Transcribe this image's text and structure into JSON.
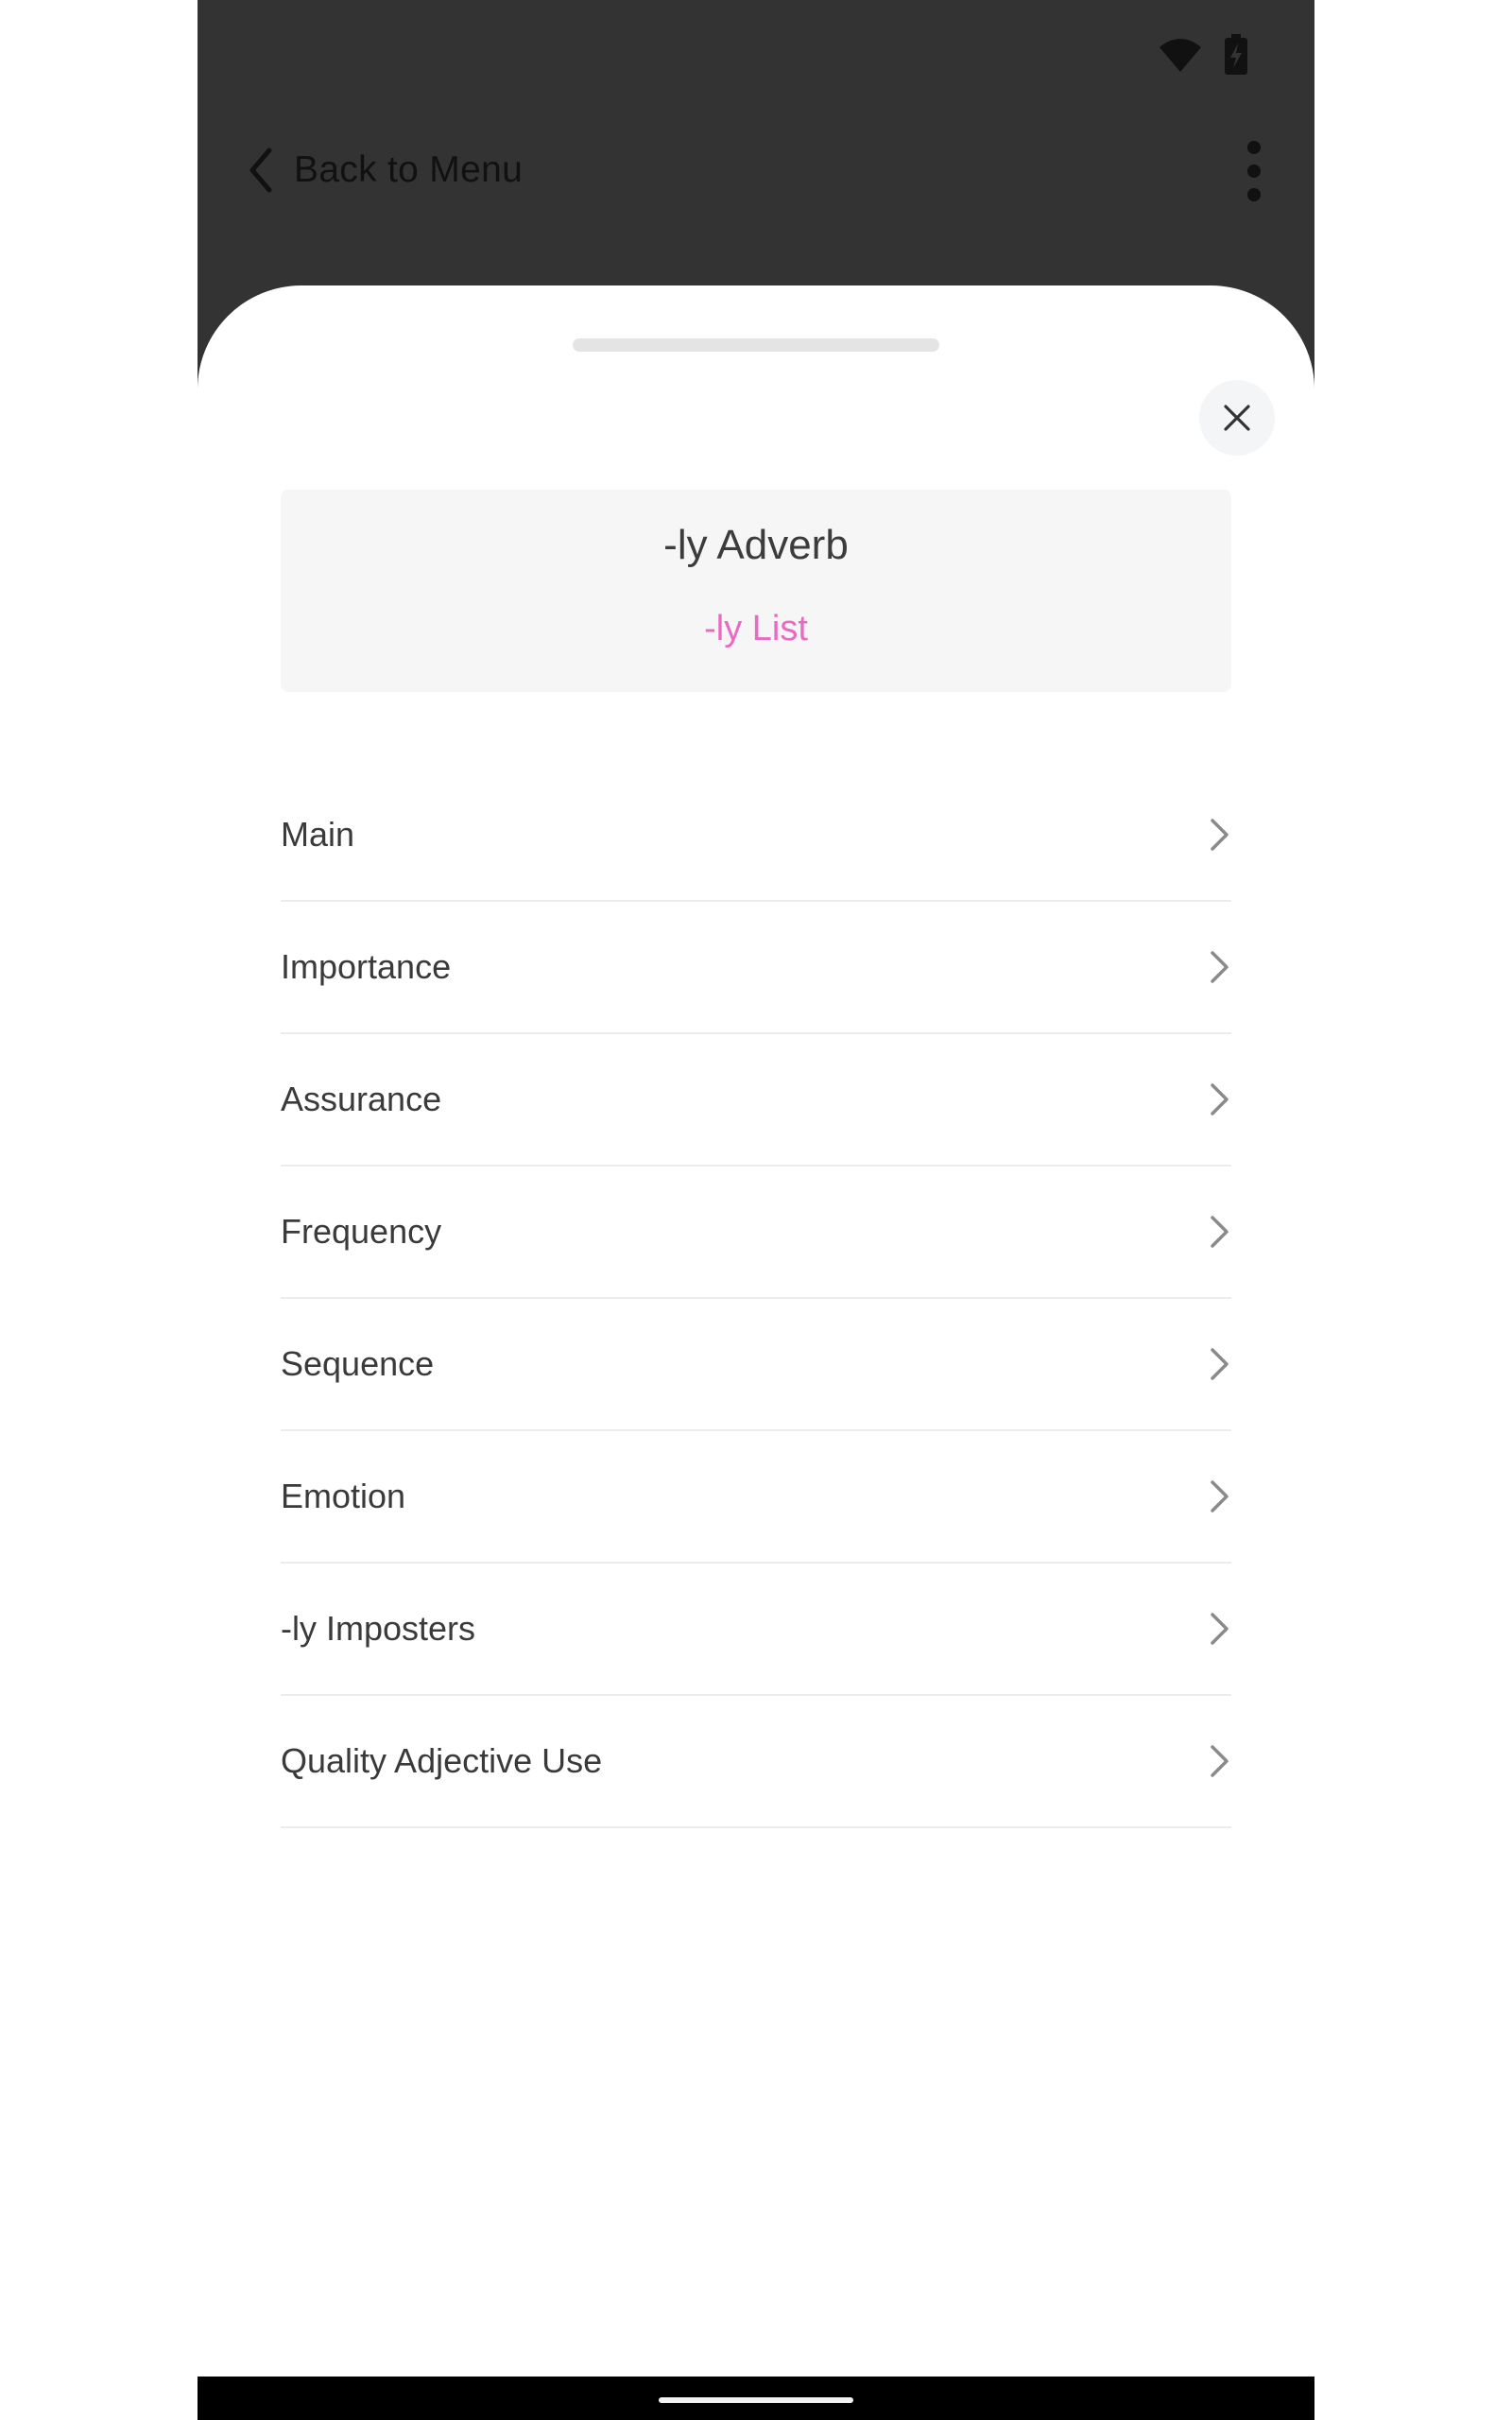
{
  "header": {
    "back_label": "Back to Menu"
  },
  "sheet": {
    "title": "-ly Adverb",
    "subtitle_link": "-ly List"
  },
  "menu": {
    "items": [
      {
        "label": "Main"
      },
      {
        "label": "Importance"
      },
      {
        "label": "Assurance"
      },
      {
        "label": "Frequency"
      },
      {
        "label": "Sequence"
      },
      {
        "label": "Emotion"
      },
      {
        "label": "-ly Imposters"
      },
      {
        "label": "Quality Adjective Use"
      }
    ]
  },
  "icons": {
    "status": [
      "wifi-icon",
      "battery-charging-icon"
    ],
    "toolbar": [
      "chevron-left-icon",
      "more-vertical-icon"
    ],
    "sheet": [
      "close-icon"
    ],
    "rows": "chevron-right-icon"
  },
  "colors": {
    "top_background": "#333333",
    "sheet_background": "#ffffff",
    "accent_pink": "#e96ac2",
    "text_primary": "#3a3a3a",
    "card_background": "#f6f6f6"
  }
}
